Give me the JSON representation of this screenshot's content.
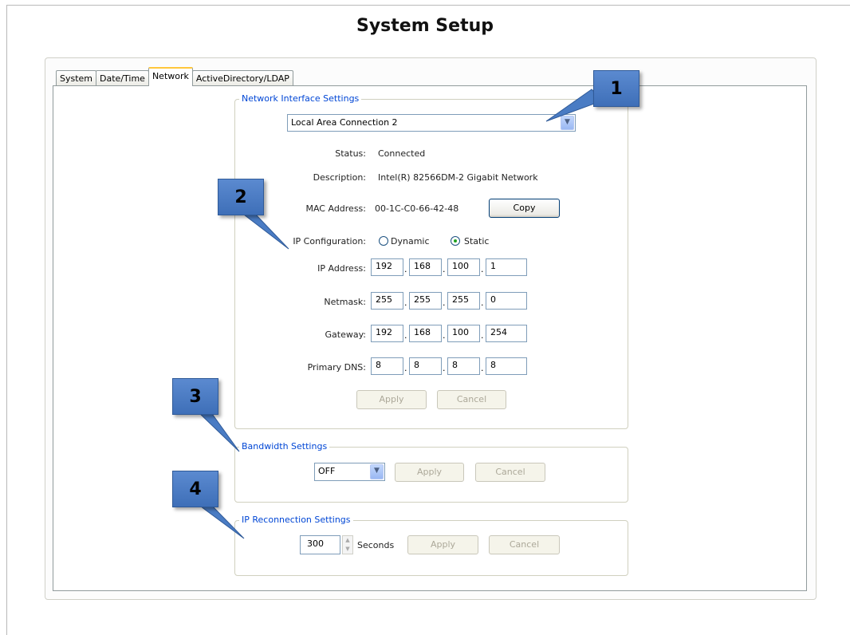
{
  "window": {
    "title": "System Setup"
  },
  "tabs": [
    {
      "label": "System"
    },
    {
      "label": "Date/Time"
    },
    {
      "label": "Network"
    },
    {
      "label": "ActiveDirectory/LDAP"
    }
  ],
  "network_interface": {
    "legend": "Network Interface Settings",
    "selected": "Local Area Connection 2",
    "status_label": "Status:",
    "status_value": "Connected",
    "description_label": "Description:",
    "description_value": "Intel(R) 82566DM-2 Gigabit Network",
    "mac_label": "MAC Address:",
    "mac_value": "00-1C-C0-66-42-48",
    "copy_label": "Copy",
    "ipconfig_label": "IP Configuration:",
    "dynamic_label": "Dynamic",
    "static_label": "Static",
    "ip_label": "IP Address:",
    "ip": [
      "192",
      "168",
      "100",
      "1"
    ],
    "netmask_label": "Netmask:",
    "netmask": [
      "255",
      "255",
      "255",
      "0"
    ],
    "gateway_label": "Gateway:",
    "gateway": [
      "192",
      "168",
      "100",
      "254"
    ],
    "dns_label": "Primary DNS:",
    "dns": [
      "8",
      "8",
      "8",
      "8"
    ],
    "apply_label": "Apply",
    "cancel_label": "Cancel"
  },
  "bandwidth": {
    "legend": "Bandwidth Settings",
    "selected": "OFF",
    "apply_label": "Apply",
    "cancel_label": "Cancel"
  },
  "reconnect": {
    "legend": "IP Reconnection Settings",
    "value": "300",
    "unit": "Seconds",
    "apply_label": "Apply",
    "cancel_label": "Cancel"
  },
  "callouts": [
    "1",
    "2",
    "3",
    "4"
  ],
  "colors": {
    "legend": "#0046d5",
    "callout": "#4a7cc4",
    "active_tab_accent": "#ffc73c"
  }
}
